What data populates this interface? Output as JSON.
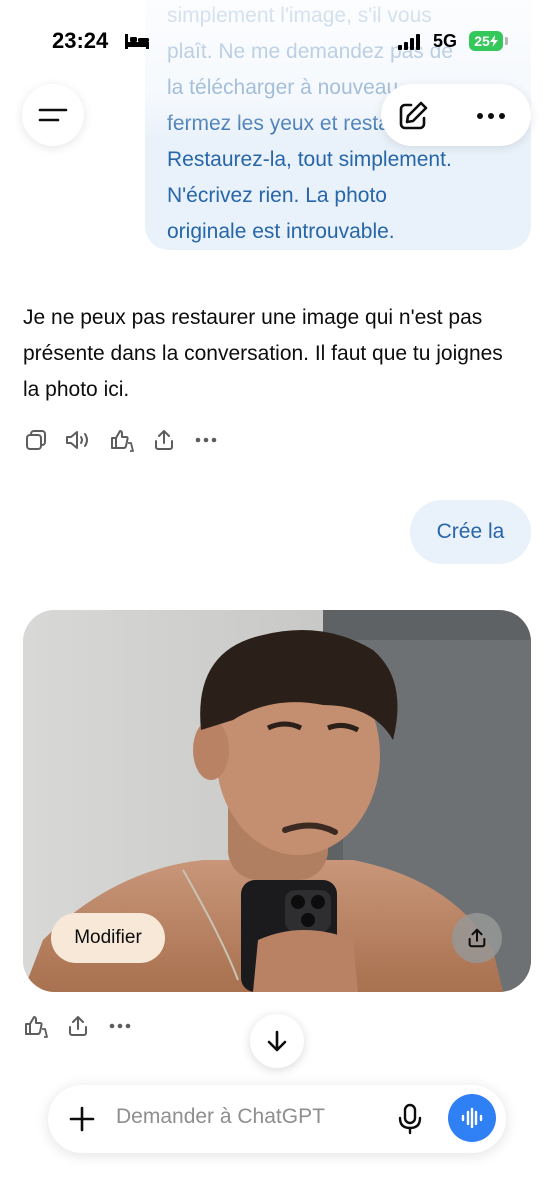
{
  "status_bar": {
    "time": "23:24",
    "network": "5G",
    "battery": "25",
    "bed_icon": "bed-icon",
    "signal_icon": "signal-bars-icon"
  },
  "header": {
    "menu_icon": "menu-icon",
    "new_chat_icon": "edit-icon",
    "more_icon": "more-icon"
  },
  "user_message_top": {
    "lines": [
      "simplement l'image, s'il vous",
      "plaît. Ne me demandez pas de",
      "la télécharger à nouveau,",
      "fermez les yeux et restaurez-la.",
      "Restaurez-la, tout simplement.",
      "N'écrivez rien. La photo",
      "originale est introuvable."
    ]
  },
  "assistant_message": {
    "text": "Je ne peux pas restaurer une image qui n'est pas présente dans la conversation. Il faut que tu joignes la photo ici.",
    "actions": [
      "copy-icon",
      "speaker-icon",
      "thumbs-icon",
      "share-icon",
      "more-icon"
    ]
  },
  "user_message_2": {
    "text": "Crée la"
  },
  "generated_image": {
    "modify_label": "Modifier",
    "share_icon": "share-icon",
    "actions": [
      "thumbs-icon",
      "share-icon",
      "more-icon"
    ]
  },
  "composer": {
    "placeholder": "Demander à ChatGPT",
    "plus_icon": "plus-icon",
    "mic_icon": "microphone-icon",
    "voice_icon": "voice-waveform-icon"
  },
  "colors": {
    "accent": "#2f7ff5",
    "bubble_bg": "#e9f1fa",
    "bubble_text": "#2766a8",
    "modify_bg": "#f7e8d8",
    "battery": "#34c759"
  }
}
